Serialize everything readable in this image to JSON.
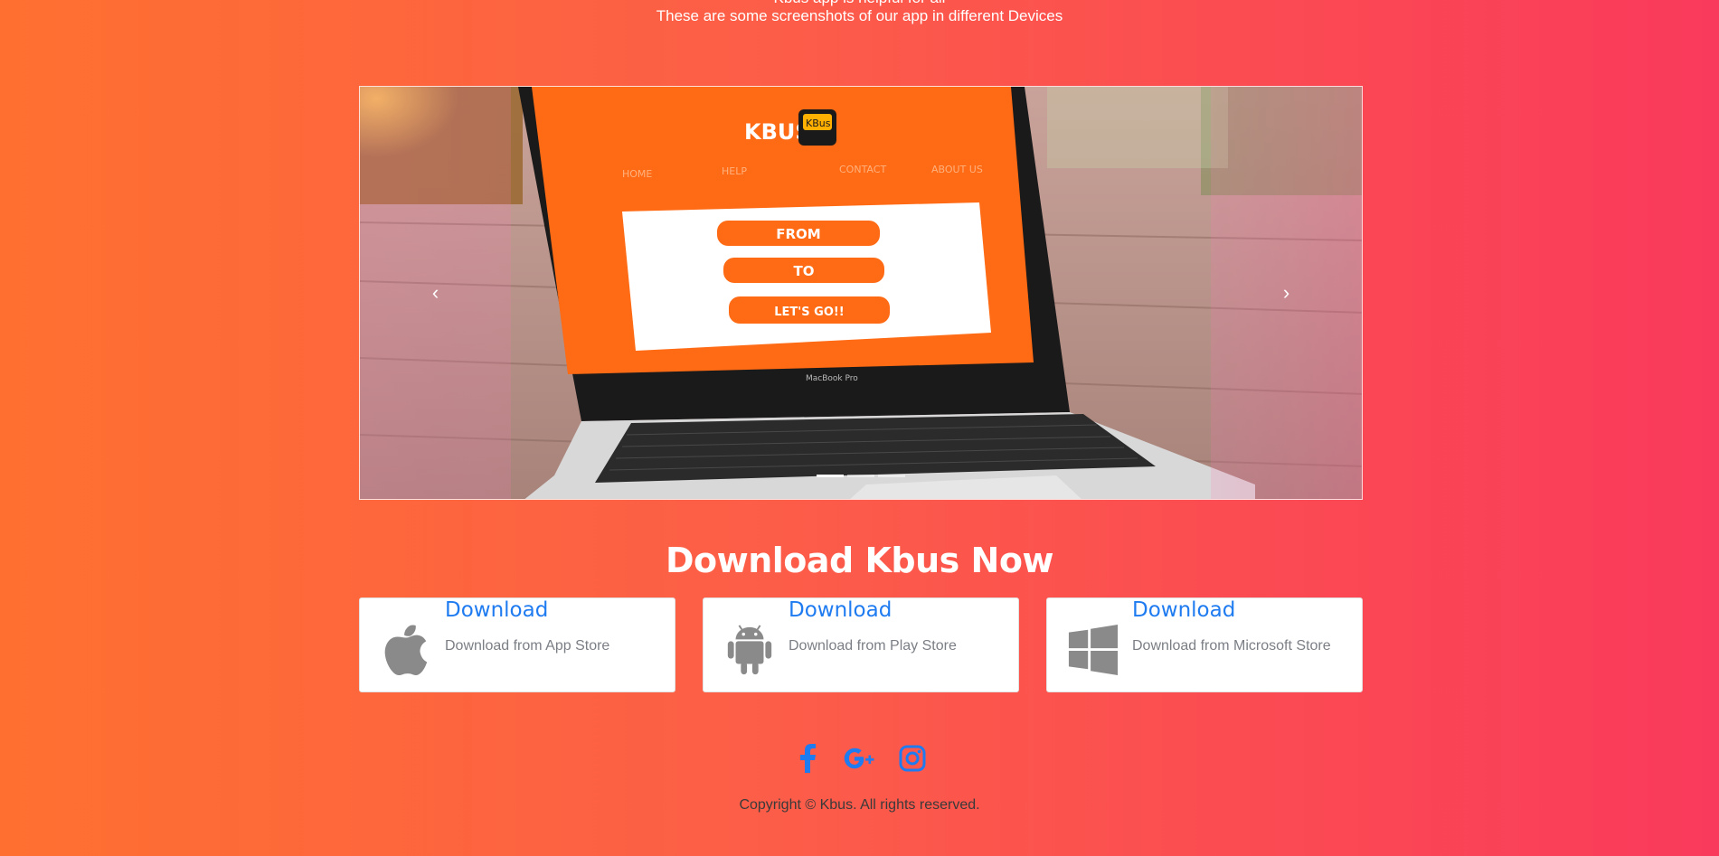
{
  "intro": {
    "cut_line": "Kbus app is helpful for all",
    "subtitle": "These are some screenshots of our app in different Devices"
  },
  "carousel": {
    "screen": {
      "brand": "KBUS",
      "logo_text": "KBus",
      "nav": [
        "HOME",
        "HELP",
        "CONTACT",
        "ABOUT US"
      ],
      "buttons": [
        "FROM",
        "TO",
        "LET'S GO!!"
      ],
      "laptop_label": "MacBook Pro"
    },
    "prev_glyph": "‹",
    "next_glyph": "›",
    "slide_count": 3,
    "active_slide": 1
  },
  "download": {
    "heading": "Download Kbus Now",
    "cards": [
      {
        "title": "Download",
        "desc": "Download from App Store",
        "icon": "apple-icon"
      },
      {
        "title": "Download",
        "desc": "Download from Play Store",
        "icon": "android-icon"
      },
      {
        "title": "Download",
        "desc": "Download from Microsoft Store",
        "icon": "windows-icon"
      }
    ]
  },
  "social": {
    "icons": [
      "facebook-icon",
      "google-plus-icon",
      "instagram-icon"
    ],
    "color": "#1f7bf0"
  },
  "footer": {
    "copyright": "Copyright © Kbus. All rights reserved."
  },
  "colors": {
    "gradient_left": "#ff7030",
    "gradient_right": "#fa3a5c",
    "link_blue": "#1f7bf0",
    "screen_orange": "#ff6a14"
  }
}
